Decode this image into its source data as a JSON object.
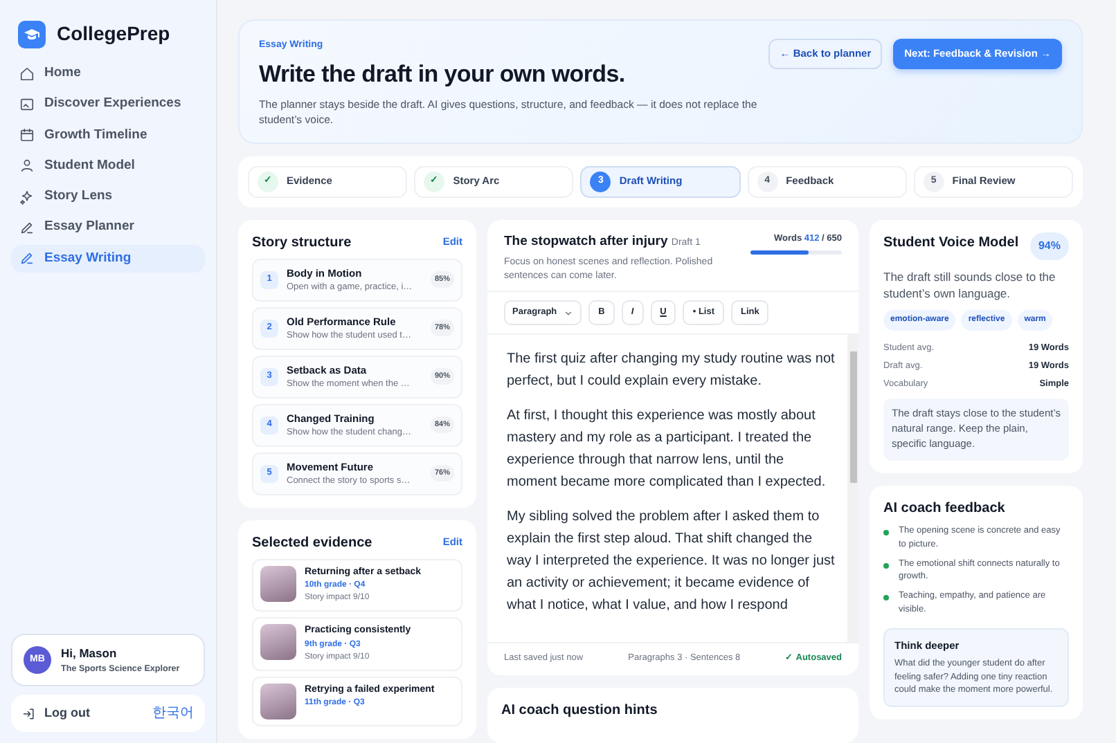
{
  "sidebar": {
    "brand": "CollegePrep",
    "items": [
      {
        "label": "Home",
        "selected": false
      },
      {
        "label": "Discover Experiences",
        "selected": false
      },
      {
        "label": "Growth Timeline",
        "selected": false
      },
      {
        "label": "Student Model",
        "selected": false
      },
      {
        "label": "Story Lens",
        "selected": false
      },
      {
        "label": "Essay Planner",
        "selected": false
      },
      {
        "label": "Essay Writing",
        "selected": true
      }
    ],
    "user": {
      "initials": "MB",
      "greeting": "Hi, Mason",
      "role": "The Sports Science Explorer"
    },
    "logout": "Log out",
    "language": "한국어"
  },
  "hero": {
    "eyebrow": "Essay Writing",
    "title": "Write the draft in your own words.",
    "subtitle": "The planner stays beside the draft. AI gives questions, structure, and feedback — it does not replace the student’s voice.",
    "back_button": "← Back to planner",
    "next_button": "Next: Feedback & Revision →"
  },
  "steps": [
    {
      "marker": "✓",
      "label": "Evidence",
      "completed": true,
      "selected": false
    },
    {
      "marker": "✓",
      "label": "Story Arc",
      "completed": true,
      "selected": false
    },
    {
      "marker": "3",
      "label": "Draft Writing",
      "completed": false,
      "selected": true
    },
    {
      "marker": "4",
      "label": "Feedback",
      "completed": false,
      "selected": false
    },
    {
      "marker": "5",
      "label": "Final Review",
      "completed": false,
      "selected": false
    }
  ],
  "story_structure": {
    "title": "Story structure",
    "edit": "Edit",
    "items": [
      {
        "number": "1",
        "title": "Body in Motion",
        "description": "Open with a game, practice, i…",
        "percent": "85%"
      },
      {
        "number": "2",
        "title": "Old Performance Rule",
        "description": "Show how the student used t…",
        "percent": "78%"
      },
      {
        "number": "3",
        "title": "Setback as Data",
        "description": "Show the moment when the …",
        "percent": "90%"
      },
      {
        "number": "4",
        "title": "Changed Training",
        "description": "Show how the student chang…",
        "percent": "84%"
      },
      {
        "number": "5",
        "title": "Movement Future",
        "description": "Connect the story to sports s…",
        "percent": "76%"
      }
    ]
  },
  "selected_evidence": {
    "title": "Selected evidence",
    "edit": "Edit",
    "items": [
      {
        "title": "Returning after a setback",
        "meta": "10th grade · Q4",
        "impact": "Story impact 9/10"
      },
      {
        "title": "Practicing consistently",
        "meta": "9th grade · Q3",
        "impact": "Story impact 9/10"
      },
      {
        "title": "Retrying a failed experiment",
        "meta": "11th grade · Q3"
      }
    ]
  },
  "draft": {
    "title": "The stopwatch after injury",
    "draft_label": "Draft 1",
    "hint": "Focus on honest scenes and reflection. Polished sentences can come later.",
    "words_label": "Words",
    "words": "412",
    "words_limit": "/ 650",
    "level": 0.634,
    "toolbar": {
      "format": "Paragraph",
      "buttons": [
        "B",
        "I",
        "U",
        "• List",
        "Link"
      ]
    },
    "paragraphs": [
      "The first quiz after changing my study routine was not perfect, but I could explain every mistake.",
      "At first, I thought this experience was mostly about mastery and my role as a participant. I treated the experience through that narrow lens, until the moment became more complicated than I expected.",
      "My sibling solved the problem after I asked them to explain the first step aloud. That shift changed the way I interpreted the experience. It was no longer just an activity or achievement; it became evidence of what I notice, what I value, and how I respond"
    ],
    "last_saved": "Last saved just now",
    "counts": "Paragraphs 3 · Sentences 8",
    "autosaved": "✓ Autosaved"
  },
  "question_hints": {
    "title": "AI coach question hints"
  },
  "voice_model": {
    "title": "Student Voice Model",
    "score": "94%",
    "summary": "The draft still sounds close to the student’s own language.",
    "tags": [
      "emotion-aware",
      "reflective",
      "warm"
    ],
    "stats": [
      {
        "label": "Student avg.",
        "value": "19 Words"
      },
      {
        "label": "Draft avg.",
        "value": "19 Words"
      },
      {
        "label": "Vocabulary",
        "value": "Simple"
      }
    ],
    "note": "The draft stays close to the student’s natural range. Keep the plain, specific language."
  },
  "coach_feedback": {
    "title": "AI coach feedback",
    "items": [
      "The opening scene is concrete and easy to picture.",
      "The emotional shift connects naturally to growth.",
      "Teaching, empathy, and patience are visible."
    ],
    "think_deeper": {
      "title": "Think deeper",
      "text": "What did the younger student do after feeling safer? Adding one tiny reaction could make the moment more powerful."
    }
  }
}
